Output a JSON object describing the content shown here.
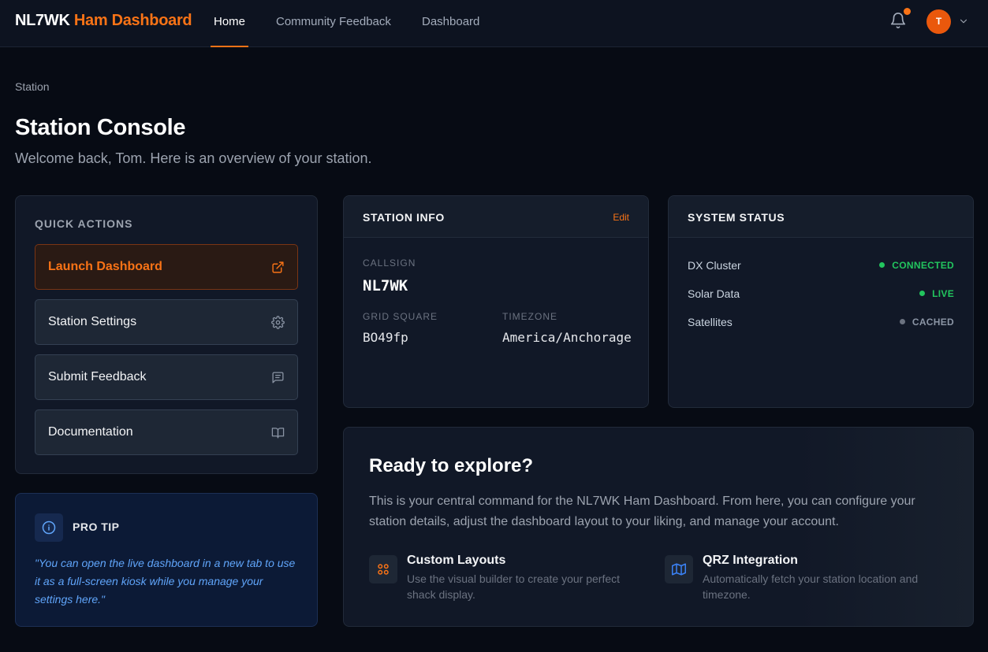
{
  "nav": {
    "brand_primary": "NL7WK",
    "brand_accent": "Ham Dashboard",
    "links": [
      {
        "label": "Home",
        "active": true
      },
      {
        "label": "Community Feedback",
        "active": false
      },
      {
        "label": "Dashboard",
        "active": false
      }
    ],
    "avatar_initial": "T",
    "notification_icon": "bell-icon",
    "accent_color": "#f97316"
  },
  "header": {
    "breadcrumb": "Station",
    "title": "Station Console",
    "subtitle": "Welcome back, Tom. Here is an overview of your station."
  },
  "quick_actions": {
    "heading": "QUICK ACTIONS",
    "items": [
      {
        "label": "Launch Dashboard",
        "icon": "external-link-icon",
        "primary": true
      },
      {
        "label": "Station Settings",
        "icon": "gear-icon",
        "primary": false
      },
      {
        "label": "Submit Feedback",
        "icon": "message-icon",
        "primary": false
      },
      {
        "label": "Documentation",
        "icon": "book-icon",
        "primary": false
      }
    ]
  },
  "pro_tip": {
    "heading": "PRO TIP",
    "icon": "info-icon",
    "text": "\"You can open the live dashboard in a new tab to use it as a full-screen kiosk while you manage your settings here.\""
  },
  "station_info": {
    "title": "STATION INFO",
    "edit_label": "Edit",
    "callsign_label": "CALLSIGN",
    "callsign": "NL7WK",
    "grid_label": "GRID SQUARE",
    "grid": "BO49fp",
    "timezone_label": "TIMEZONE",
    "timezone": "America/Anchorage"
  },
  "system_status": {
    "title": "SYSTEM STATUS",
    "rows": [
      {
        "name": "DX Cluster",
        "value": "CONNECTED",
        "color": "#22c55e"
      },
      {
        "name": "Solar Data",
        "value": "LIVE",
        "color": "#22c55e"
      },
      {
        "name": "Satellites",
        "value": "CACHED",
        "color": "#6b7280"
      }
    ]
  },
  "explore": {
    "title": "Ready to explore?",
    "text": "This is your central command for the NL7WK Ham Dashboard. From here, you can configure your station details, adjust the dashboard layout to your liking, and manage your account.",
    "features": [
      {
        "title": "Custom Layouts",
        "desc": "Use the visual builder to create your perfect shack display.",
        "icon": "grid-icon"
      },
      {
        "title": "QRZ Integration",
        "desc": "Automatically fetch your station location and timezone.",
        "icon": "map-icon"
      }
    ]
  }
}
